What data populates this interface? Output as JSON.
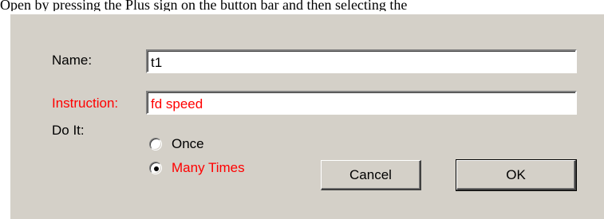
{
  "caption": "Open by pressing the Plus sign on the button bar and then selecting the",
  "dialog": {
    "name_label": "Name:",
    "name_value": "t1",
    "instruction_label": "Instruction:",
    "instruction_value": "fd speed",
    "doit_label": "Do It:",
    "options": [
      {
        "label": "Once",
        "selected": false
      },
      {
        "label": "Many Times",
        "selected": true
      }
    ],
    "cancel_label": "Cancel",
    "ok_label": "OK"
  },
  "colors": {
    "dialog_background": "#d4d0c8",
    "highlight_text": "#ff0000",
    "normal_text": "#000000"
  }
}
